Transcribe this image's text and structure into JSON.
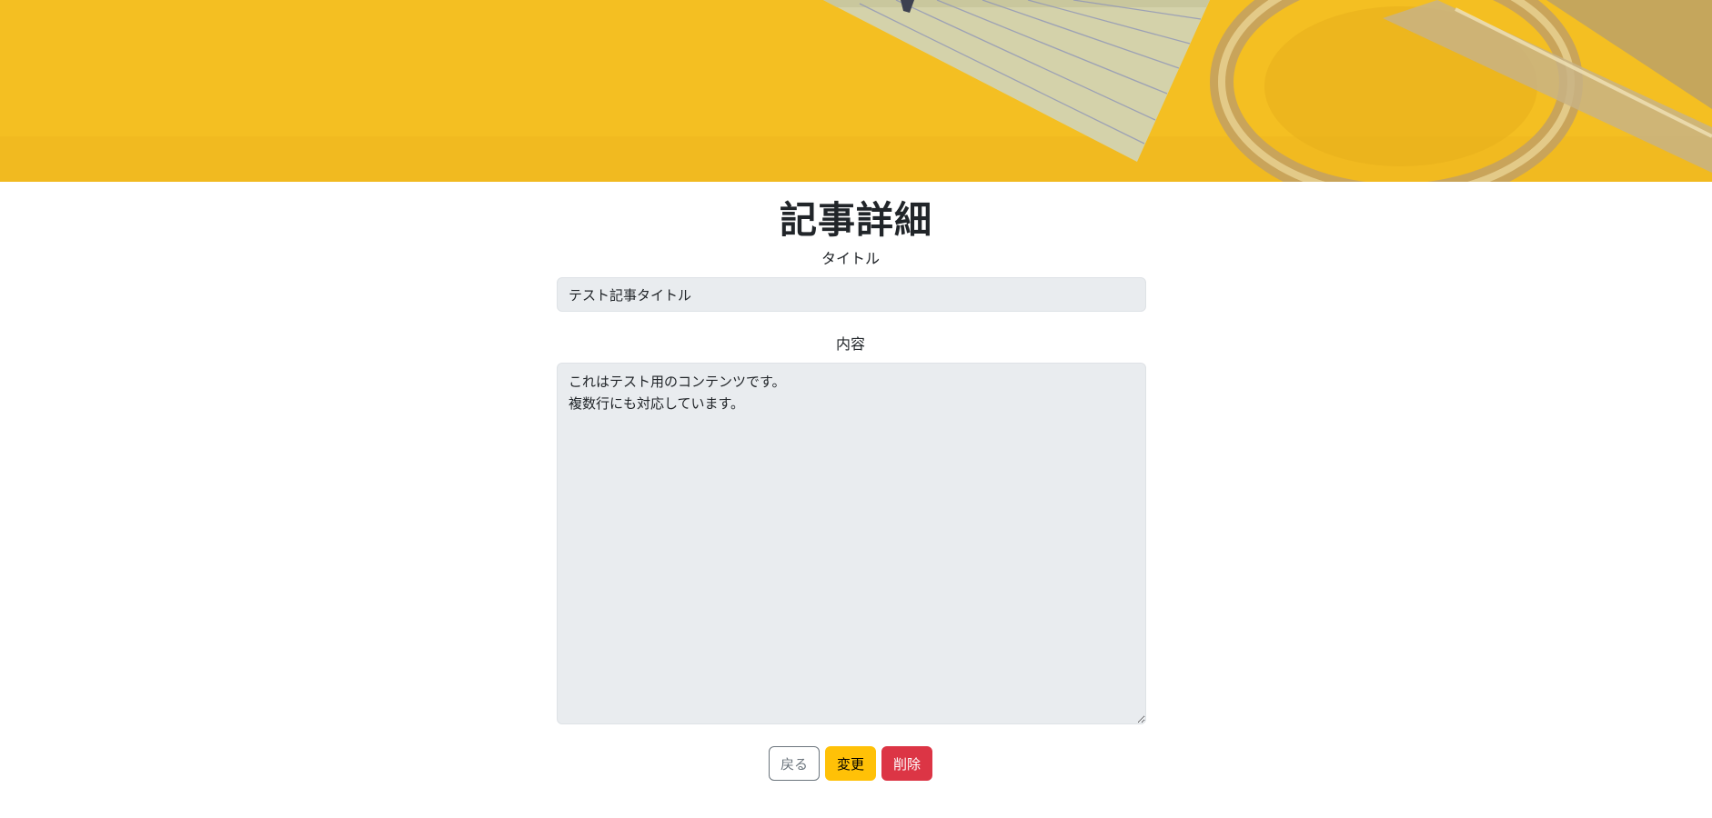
{
  "page": {
    "title": "記事詳細"
  },
  "form": {
    "title_label": "タイトル",
    "title_value": "テスト記事タイトル",
    "content_label": "内容",
    "content_value": "これはテスト用のコンテンツです。\n複数行にも対応しています。"
  },
  "buttons": {
    "back_label": "戻る",
    "edit_label": "変更",
    "delete_label": "削除"
  },
  "colors": {
    "hero_background": "#f4bf22",
    "edit_button": "#ffc107",
    "delete_button": "#dc3545",
    "back_button_border": "#6c757d",
    "input_background": "#e9ecef"
  }
}
